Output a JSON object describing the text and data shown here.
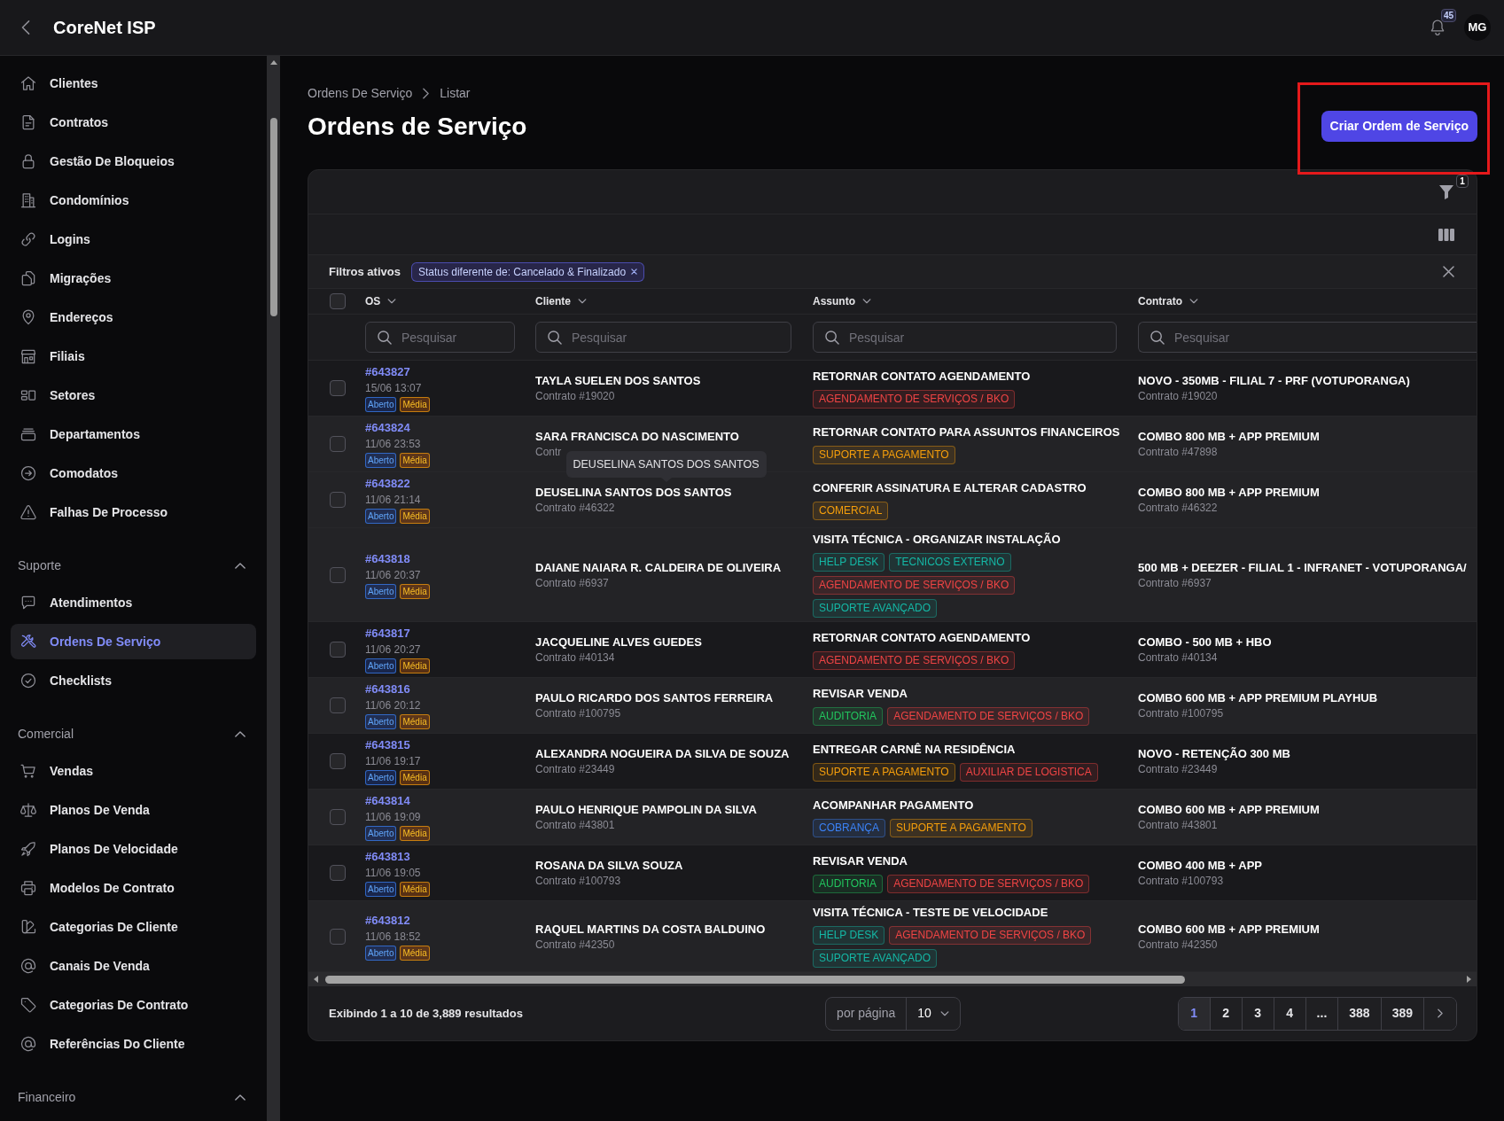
{
  "topbar": {
    "title": "CoreNet ISP",
    "notification_count": "45",
    "avatar_initials": "MG"
  },
  "sidebar": {
    "items": [
      {
        "label": "Clientes",
        "selected": false
      },
      {
        "label": "Contratos",
        "selected": false
      },
      {
        "label": "Gestão De Bloqueios",
        "selected": false
      },
      {
        "label": "Condomínios",
        "selected": false
      },
      {
        "label": "Logins",
        "selected": false
      },
      {
        "label": "Migrações",
        "selected": false
      },
      {
        "label": "Endereços",
        "selected": false
      },
      {
        "label": "Filiais",
        "selected": false
      },
      {
        "label": "Setores",
        "selected": false
      },
      {
        "label": "Departamentos",
        "selected": false
      },
      {
        "label": "Comodatos",
        "selected": false
      },
      {
        "label": "Falhas De Processo",
        "selected": false
      }
    ],
    "sections": [
      {
        "title": "Suporte",
        "expanded": true,
        "items": [
          {
            "label": "Atendimentos",
            "selected": false
          },
          {
            "label": "Ordens De Serviço",
            "selected": true
          },
          {
            "label": "Checklists",
            "selected": false
          }
        ]
      },
      {
        "title": "Comercial",
        "expanded": true,
        "items": [
          {
            "label": "Vendas",
            "selected": false
          },
          {
            "label": "Planos De Venda",
            "selected": false
          },
          {
            "label": "Planos De Velocidade",
            "selected": false
          },
          {
            "label": "Modelos De Contrato",
            "selected": false
          },
          {
            "label": "Categorias De Cliente",
            "selected": false
          },
          {
            "label": "Canais De Venda",
            "selected": false
          },
          {
            "label": "Categorias De Contrato",
            "selected": false
          },
          {
            "label": "Referências Do Cliente",
            "selected": false
          }
        ]
      },
      {
        "title": "Financeiro",
        "expanded": true
      }
    ]
  },
  "breadcrumb": [
    "Ordens De Serviço",
    "Listar"
  ],
  "page_title": "Ordens de Serviço",
  "create_button": {
    "label": "Criar Ordem de Serviço",
    "highlighted": true
  },
  "filter_count": "1",
  "active_filters": {
    "label": "Filtros ativos",
    "chips": [
      "Status diferente de: Cancelado & Finalizado"
    ]
  },
  "table": {
    "all_selected": false,
    "columns": [
      {
        "label": "OS",
        "placeholder": "Pesquisar"
      },
      {
        "label": "Cliente",
        "placeholder": "Pesquisar"
      },
      {
        "label": "Assunto",
        "placeholder": "Pesquisar"
      },
      {
        "label": "Contrato",
        "placeholder": "Pesquisar"
      }
    ],
    "rows": [
      {
        "selected": false,
        "os": "#643827",
        "date": "15/06 13:07",
        "status": "Aberto",
        "priority": "Média",
        "client": "TAYLA SUELEN DOS SANTOS",
        "client_contract": "Contrato #19020",
        "subject": "RETORNAR CONTATO AGENDAMENTO",
        "tags": [
          {
            "label": "AGENDAMENTO DE SERVIÇOS / BKO",
            "color": "#ef4444"
          }
        ],
        "plan": "NOVO - 350MB - FILIAL 7 - PRF (VOTUPORANGA)",
        "plan_contract": "Contrato #19020"
      },
      {
        "selected": false,
        "os": "#643824",
        "date": "11/06 23:53",
        "status": "Aberto",
        "priority": "Média",
        "client": "SARA FRANCISCA DO NASCIMENTO",
        "client_contract": "Contr",
        "subject": "RETORNAR CONTATO PARA ASSUNTOS FINANCEIROS",
        "tags": [
          {
            "label": "SUPORTE A PAGAMENTO",
            "color": "#f59e0b"
          }
        ],
        "plan": "COMBO 800 MB + APP PREMIUM",
        "plan_contract": "Contrato #47898"
      },
      {
        "selected": false,
        "os": "#643822",
        "date": "11/06 21:14",
        "status": "Aberto",
        "priority": "Média",
        "client": "DEUSELINA SANTOS DOS SANTOS",
        "client_contract": "Contrato #46322",
        "tooltip": "DEUSELINA SANTOS DOS SANTOS",
        "subject": "CONFERIR ASSINATURA E ALTERAR CADASTRO",
        "tags": [
          {
            "label": "COMERCIAL",
            "color": "#f59e0b"
          }
        ],
        "plan": "COMBO 800 MB + APP PREMIUM",
        "plan_contract": "Contrato #46322"
      },
      {
        "selected": false,
        "os": "#643818",
        "date": "11/06 20:37",
        "status": "Aberto",
        "priority": "Média",
        "client": "DAIANE NAIARA R. CALDEIRA DE OLIVEIRA",
        "client_contract": "Contrato #6937",
        "subject": "VISITA TÉCNICA - ORGANIZAR INSTALAÇÃO",
        "tags": [
          {
            "label": "HELP DESK",
            "color": "#14b8a6"
          },
          {
            "label": "TECNICOS EXTERNO",
            "color": "#14b8a6"
          },
          {
            "label": "AGENDAMENTO DE SERVIÇOS / BKO",
            "color": "#ef4444"
          },
          {
            "label": "SUPORTE AVANÇADO",
            "color": "#14b8a6"
          }
        ],
        "plan": "500 MB + DEEZER - FILIAL 1 - INFRANET - VOTUPORANGA/",
        "plan_contract": "Contrato #6937"
      },
      {
        "selected": false,
        "os": "#643817",
        "date": "11/06 20:27",
        "status": "Aberto",
        "priority": "Média",
        "client": "JACQUELINE ALVES GUEDES",
        "client_contract": "Contrato #40134",
        "subject": "RETORNAR CONTATO AGENDAMENTO",
        "tags": [
          {
            "label": "AGENDAMENTO DE SERVIÇOS / BKO",
            "color": "#ef4444"
          }
        ],
        "plan": "COMBO - 500 MB + HBO",
        "plan_contract": "Contrato #40134"
      },
      {
        "selected": false,
        "os": "#643816",
        "date": "11/06 20:12",
        "status": "Aberto",
        "priority": "Média",
        "client": "PAULO RICARDO DOS SANTOS FERREIRA",
        "client_contract": "Contrato #100795",
        "subject": "REVISAR VENDA",
        "tags": [
          {
            "label": "AUDITORIA",
            "color": "#22c55e"
          },
          {
            "label": "AGENDAMENTO DE SERVIÇOS / BKO",
            "color": "#ef4444"
          }
        ],
        "plan": "COMBO 600 MB + APP PREMIUM PLAYHUB",
        "plan_contract": "Contrato #100795"
      },
      {
        "selected": false,
        "os": "#643815",
        "date": "11/06 19:17",
        "status": "Aberto",
        "priority": "Média",
        "client": "ALEXANDRA NOGUEIRA DA SILVA DE SOUZA",
        "client_contract": "Contrato #23449",
        "subject": "ENTREGAR CARNÊ NA RESIDÊNCIA",
        "tags": [
          {
            "label": "SUPORTE A PAGAMENTO",
            "color": "#f59e0b"
          },
          {
            "label": "AUXILIAR DE LOGISTICA",
            "color": "#ef4444"
          }
        ],
        "plan": "NOVO - RETENÇÃO 300 MB",
        "plan_contract": "Contrato #23449"
      },
      {
        "selected": false,
        "os": "#643814",
        "date": "11/06 19:09",
        "status": "Aberto",
        "priority": "Média",
        "client": "PAULO HENRIQUE PAMPOLIN DA SILVA",
        "client_contract": "Contrato #43801",
        "subject": "ACOMPANHAR PAGAMENTO",
        "tags": [
          {
            "label": "COBRANÇA",
            "color": "#3b82f6"
          },
          {
            "label": "SUPORTE A PAGAMENTO",
            "color": "#f59e0b"
          }
        ],
        "plan": "COMBO 600 MB + APP PREMIUM",
        "plan_contract": "Contrato #43801"
      },
      {
        "selected": false,
        "os": "#643813",
        "date": "11/06 19:05",
        "status": "Aberto",
        "priority": "Média",
        "client": "ROSANA DA SILVA SOUZA",
        "client_contract": "Contrato #100793",
        "subject": "REVISAR VENDA",
        "tags": [
          {
            "label": "AUDITORIA",
            "color": "#22c55e"
          },
          {
            "label": "AGENDAMENTO DE SERVIÇOS / BKO",
            "color": "#ef4444"
          }
        ],
        "plan": "COMBO 400 MB + APP",
        "plan_contract": "Contrato #100793"
      },
      {
        "selected": false,
        "os": "#643812",
        "date": "11/06 18:52",
        "status": "Aberto",
        "priority": "Média",
        "client": "RAQUEL MARTINS DA COSTA BALDUINO",
        "client_contract": "Contrato #42350",
        "subject": "VISITA TÉCNICA - TESTE DE VELOCIDADE",
        "tags": [
          {
            "label": "HELP DESK",
            "color": "#14b8a6"
          },
          {
            "label": "AGENDAMENTO DE SERVIÇOS / BKO",
            "color": "#ef4444"
          },
          {
            "label": "SUPORTE AVANÇADO",
            "color": "#14b8a6"
          }
        ],
        "plan": "COMBO 600 MB + APP PREMIUM",
        "plan_contract": "Contrato #42350"
      }
    ]
  },
  "footer": {
    "summary": "Exibindo 1 a 10 de 3,889 resultados",
    "per_page_label": "por página",
    "per_page": "10",
    "pages": [
      {
        "label": "1",
        "selected": true
      },
      {
        "label": "2",
        "selected": false
      },
      {
        "label": "3",
        "selected": false
      },
      {
        "label": "4",
        "selected": false
      },
      {
        "label": "...",
        "selected": false
      },
      {
        "label": "388",
        "selected": false
      },
      {
        "label": "389",
        "selected": false
      }
    ]
  }
}
